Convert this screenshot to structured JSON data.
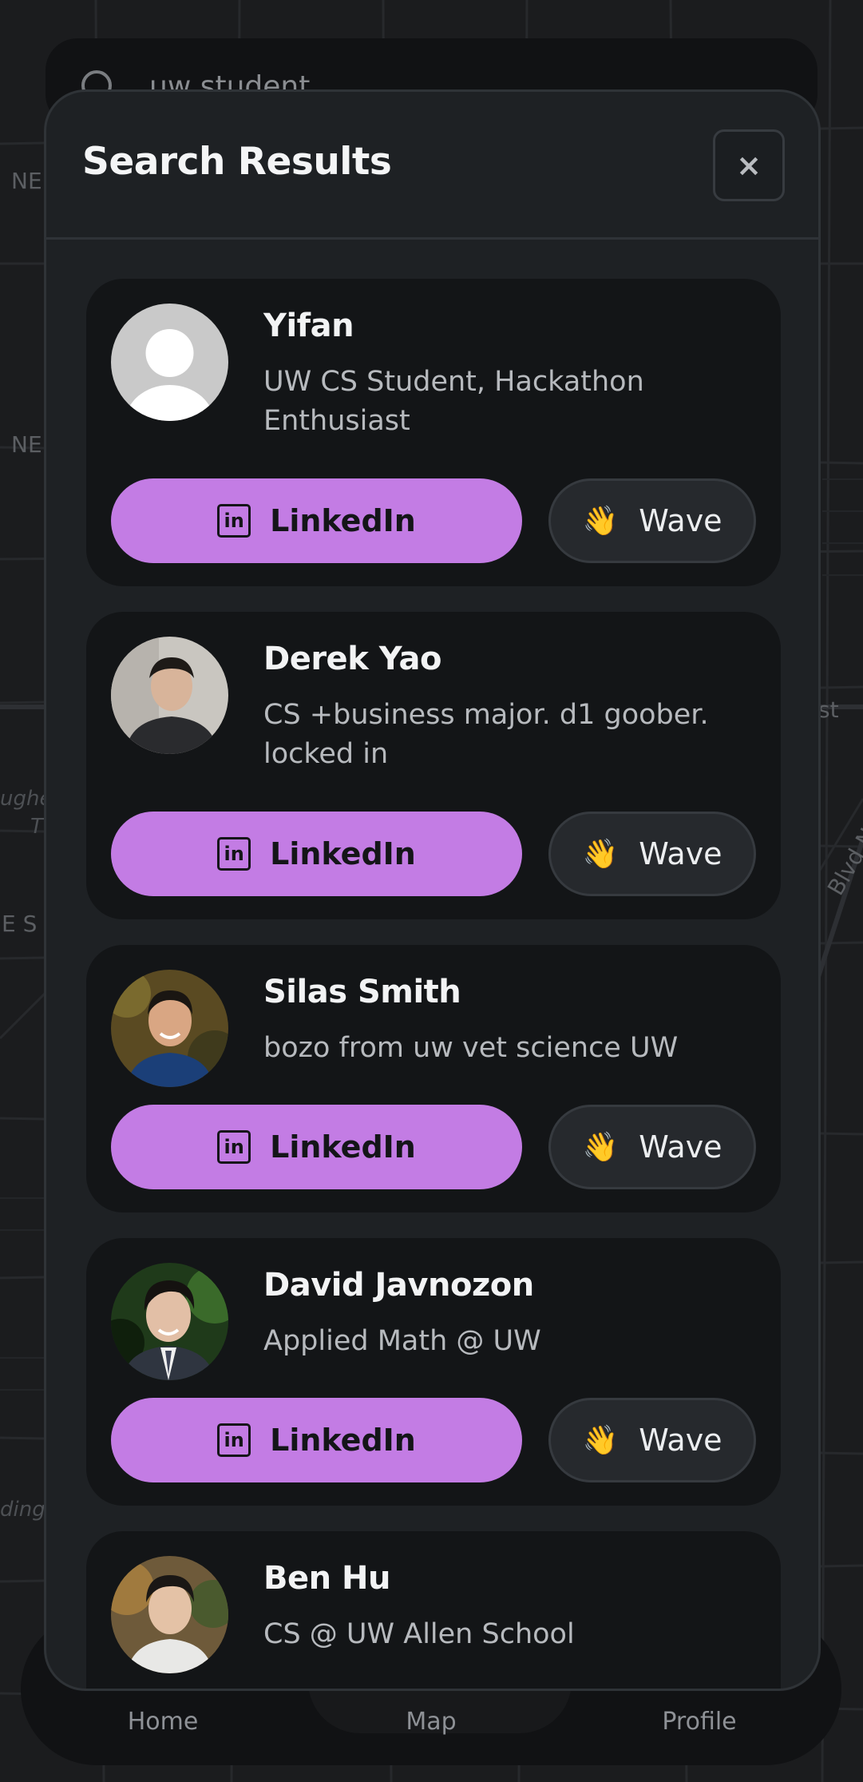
{
  "search": {
    "query": "uw student"
  },
  "map": {
    "labels": [
      "NE",
      "NE",
      "NE",
      "E S",
      "Blvd NE",
      "ughes",
      "T",
      "ding",
      "st",
      "E"
    ]
  },
  "nav": {
    "home_label": "Home",
    "map_label": "Map",
    "profile_label": "Profile"
  },
  "modal": {
    "title": "Search Results",
    "close_glyph": "×"
  },
  "buttons": {
    "linkedin_label": "LinkedIn",
    "linkedin_icon_text": "in",
    "wave_label": "Wave",
    "wave_icon": "👋"
  },
  "results": [
    {
      "name": "Yifan",
      "bio": "UW CS Student, Hackathon Enthusiast",
      "avatar": "default-avatar"
    },
    {
      "name": "Derek Yao",
      "bio": "CS +business major. d1 goober. locked in",
      "avatar": "photo"
    },
    {
      "name": "Silas Smith",
      "bio": "bozo from uw vet science UW",
      "avatar": "photo"
    },
    {
      "name": "David Javnozon",
      "bio": "Applied Math @ UW",
      "avatar": "photo"
    },
    {
      "name": "Ben Hu",
      "bio": "CS @ UW Allen School",
      "avatar": "photo"
    }
  ],
  "colors": {
    "accent": "#c37ce4",
    "modal_bg": "#1e2124",
    "card_bg": "#131517",
    "map_bg": "#1b1c1e"
  }
}
